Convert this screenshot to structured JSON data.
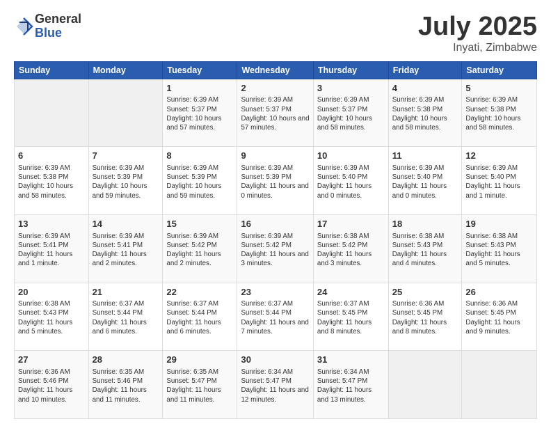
{
  "logo": {
    "general": "General",
    "blue": "Blue"
  },
  "title": {
    "month": "July 2025",
    "location": "Inyati, Zimbabwe"
  },
  "headers": [
    "Sunday",
    "Monday",
    "Tuesday",
    "Wednesday",
    "Thursday",
    "Friday",
    "Saturday"
  ],
  "weeks": [
    [
      {
        "day": "",
        "sunrise": "",
        "sunset": "",
        "daylight": ""
      },
      {
        "day": "",
        "sunrise": "",
        "sunset": "",
        "daylight": ""
      },
      {
        "day": "1",
        "sunrise": "Sunrise: 6:39 AM",
        "sunset": "Sunset: 5:37 PM",
        "daylight": "Daylight: 10 hours and 57 minutes."
      },
      {
        "day": "2",
        "sunrise": "Sunrise: 6:39 AM",
        "sunset": "Sunset: 5:37 PM",
        "daylight": "Daylight: 10 hours and 57 minutes."
      },
      {
        "day": "3",
        "sunrise": "Sunrise: 6:39 AM",
        "sunset": "Sunset: 5:37 PM",
        "daylight": "Daylight: 10 hours and 58 minutes."
      },
      {
        "day": "4",
        "sunrise": "Sunrise: 6:39 AM",
        "sunset": "Sunset: 5:38 PM",
        "daylight": "Daylight: 10 hours and 58 minutes."
      },
      {
        "day": "5",
        "sunrise": "Sunrise: 6:39 AM",
        "sunset": "Sunset: 5:38 PM",
        "daylight": "Daylight: 10 hours and 58 minutes."
      }
    ],
    [
      {
        "day": "6",
        "sunrise": "Sunrise: 6:39 AM",
        "sunset": "Sunset: 5:38 PM",
        "daylight": "Daylight: 10 hours and 58 minutes."
      },
      {
        "day": "7",
        "sunrise": "Sunrise: 6:39 AM",
        "sunset": "Sunset: 5:39 PM",
        "daylight": "Daylight: 10 hours and 59 minutes."
      },
      {
        "day": "8",
        "sunrise": "Sunrise: 6:39 AM",
        "sunset": "Sunset: 5:39 PM",
        "daylight": "Daylight: 10 hours and 59 minutes."
      },
      {
        "day": "9",
        "sunrise": "Sunrise: 6:39 AM",
        "sunset": "Sunset: 5:39 PM",
        "daylight": "Daylight: 11 hours and 0 minutes."
      },
      {
        "day": "10",
        "sunrise": "Sunrise: 6:39 AM",
        "sunset": "Sunset: 5:40 PM",
        "daylight": "Daylight: 11 hours and 0 minutes."
      },
      {
        "day": "11",
        "sunrise": "Sunrise: 6:39 AM",
        "sunset": "Sunset: 5:40 PM",
        "daylight": "Daylight: 11 hours and 0 minutes."
      },
      {
        "day": "12",
        "sunrise": "Sunrise: 6:39 AM",
        "sunset": "Sunset: 5:40 PM",
        "daylight": "Daylight: 11 hours and 1 minute."
      }
    ],
    [
      {
        "day": "13",
        "sunrise": "Sunrise: 6:39 AM",
        "sunset": "Sunset: 5:41 PM",
        "daylight": "Daylight: 11 hours and 1 minute."
      },
      {
        "day": "14",
        "sunrise": "Sunrise: 6:39 AM",
        "sunset": "Sunset: 5:41 PM",
        "daylight": "Daylight: 11 hours and 2 minutes."
      },
      {
        "day": "15",
        "sunrise": "Sunrise: 6:39 AM",
        "sunset": "Sunset: 5:42 PM",
        "daylight": "Daylight: 11 hours and 2 minutes."
      },
      {
        "day": "16",
        "sunrise": "Sunrise: 6:39 AM",
        "sunset": "Sunset: 5:42 PM",
        "daylight": "Daylight: 11 hours and 3 minutes."
      },
      {
        "day": "17",
        "sunrise": "Sunrise: 6:38 AM",
        "sunset": "Sunset: 5:42 PM",
        "daylight": "Daylight: 11 hours and 3 minutes."
      },
      {
        "day": "18",
        "sunrise": "Sunrise: 6:38 AM",
        "sunset": "Sunset: 5:43 PM",
        "daylight": "Daylight: 11 hours and 4 minutes."
      },
      {
        "day": "19",
        "sunrise": "Sunrise: 6:38 AM",
        "sunset": "Sunset: 5:43 PM",
        "daylight": "Daylight: 11 hours and 5 minutes."
      }
    ],
    [
      {
        "day": "20",
        "sunrise": "Sunrise: 6:38 AM",
        "sunset": "Sunset: 5:43 PM",
        "daylight": "Daylight: 11 hours and 5 minutes."
      },
      {
        "day": "21",
        "sunrise": "Sunrise: 6:37 AM",
        "sunset": "Sunset: 5:44 PM",
        "daylight": "Daylight: 11 hours and 6 minutes."
      },
      {
        "day": "22",
        "sunrise": "Sunrise: 6:37 AM",
        "sunset": "Sunset: 5:44 PM",
        "daylight": "Daylight: 11 hours and 6 minutes."
      },
      {
        "day": "23",
        "sunrise": "Sunrise: 6:37 AM",
        "sunset": "Sunset: 5:44 PM",
        "daylight": "Daylight: 11 hours and 7 minutes."
      },
      {
        "day": "24",
        "sunrise": "Sunrise: 6:37 AM",
        "sunset": "Sunset: 5:45 PM",
        "daylight": "Daylight: 11 hours and 8 minutes."
      },
      {
        "day": "25",
        "sunrise": "Sunrise: 6:36 AM",
        "sunset": "Sunset: 5:45 PM",
        "daylight": "Daylight: 11 hours and 8 minutes."
      },
      {
        "day": "26",
        "sunrise": "Sunrise: 6:36 AM",
        "sunset": "Sunset: 5:45 PM",
        "daylight": "Daylight: 11 hours and 9 minutes."
      }
    ],
    [
      {
        "day": "27",
        "sunrise": "Sunrise: 6:36 AM",
        "sunset": "Sunset: 5:46 PM",
        "daylight": "Daylight: 11 hours and 10 minutes."
      },
      {
        "day": "28",
        "sunrise": "Sunrise: 6:35 AM",
        "sunset": "Sunset: 5:46 PM",
        "daylight": "Daylight: 11 hours and 11 minutes."
      },
      {
        "day": "29",
        "sunrise": "Sunrise: 6:35 AM",
        "sunset": "Sunset: 5:47 PM",
        "daylight": "Daylight: 11 hours and 11 minutes."
      },
      {
        "day": "30",
        "sunrise": "Sunrise: 6:34 AM",
        "sunset": "Sunset: 5:47 PM",
        "daylight": "Daylight: 11 hours and 12 minutes."
      },
      {
        "day": "31",
        "sunrise": "Sunrise: 6:34 AM",
        "sunset": "Sunset: 5:47 PM",
        "daylight": "Daylight: 11 hours and 13 minutes."
      },
      {
        "day": "",
        "sunrise": "",
        "sunset": "",
        "daylight": ""
      },
      {
        "day": "",
        "sunrise": "",
        "sunset": "",
        "daylight": ""
      }
    ]
  ]
}
